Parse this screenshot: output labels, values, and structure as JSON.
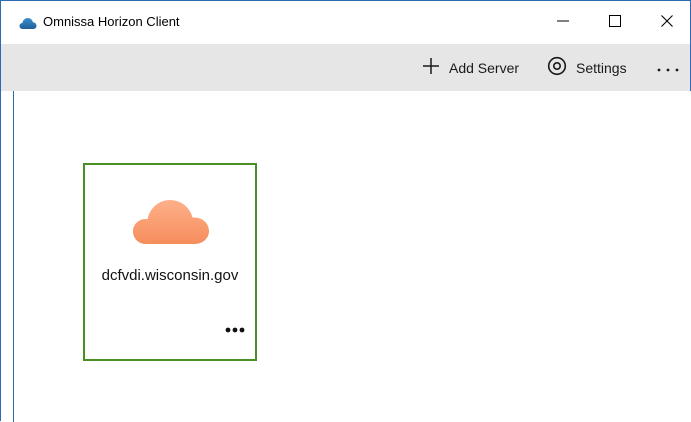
{
  "window": {
    "title": "Omnissa Horizon Client",
    "controls": {
      "minimize_icon": "minimize-icon",
      "maximize_icon": "maximize-icon",
      "close_icon": "close-icon"
    }
  },
  "toolbar": {
    "add_server_label": "Add Server",
    "add_server_icon": "plus-icon",
    "settings_label": "Settings",
    "settings_icon": "settings-icon",
    "more_icon": "more-horizontal-icon"
  },
  "servers": [
    {
      "name": "dcfvdi.wisconsin.gov",
      "icon": "cloud-icon",
      "menu_icon": "more-horizontal-icon",
      "selected": true
    }
  ],
  "colors": {
    "window_border": "#2b6bb3",
    "toolbar_bg": "#e6e6e6",
    "tile_border": "#4a8f24",
    "cloud_fill_top": "#ffae85",
    "cloud_fill_bottom": "#f7915f"
  }
}
